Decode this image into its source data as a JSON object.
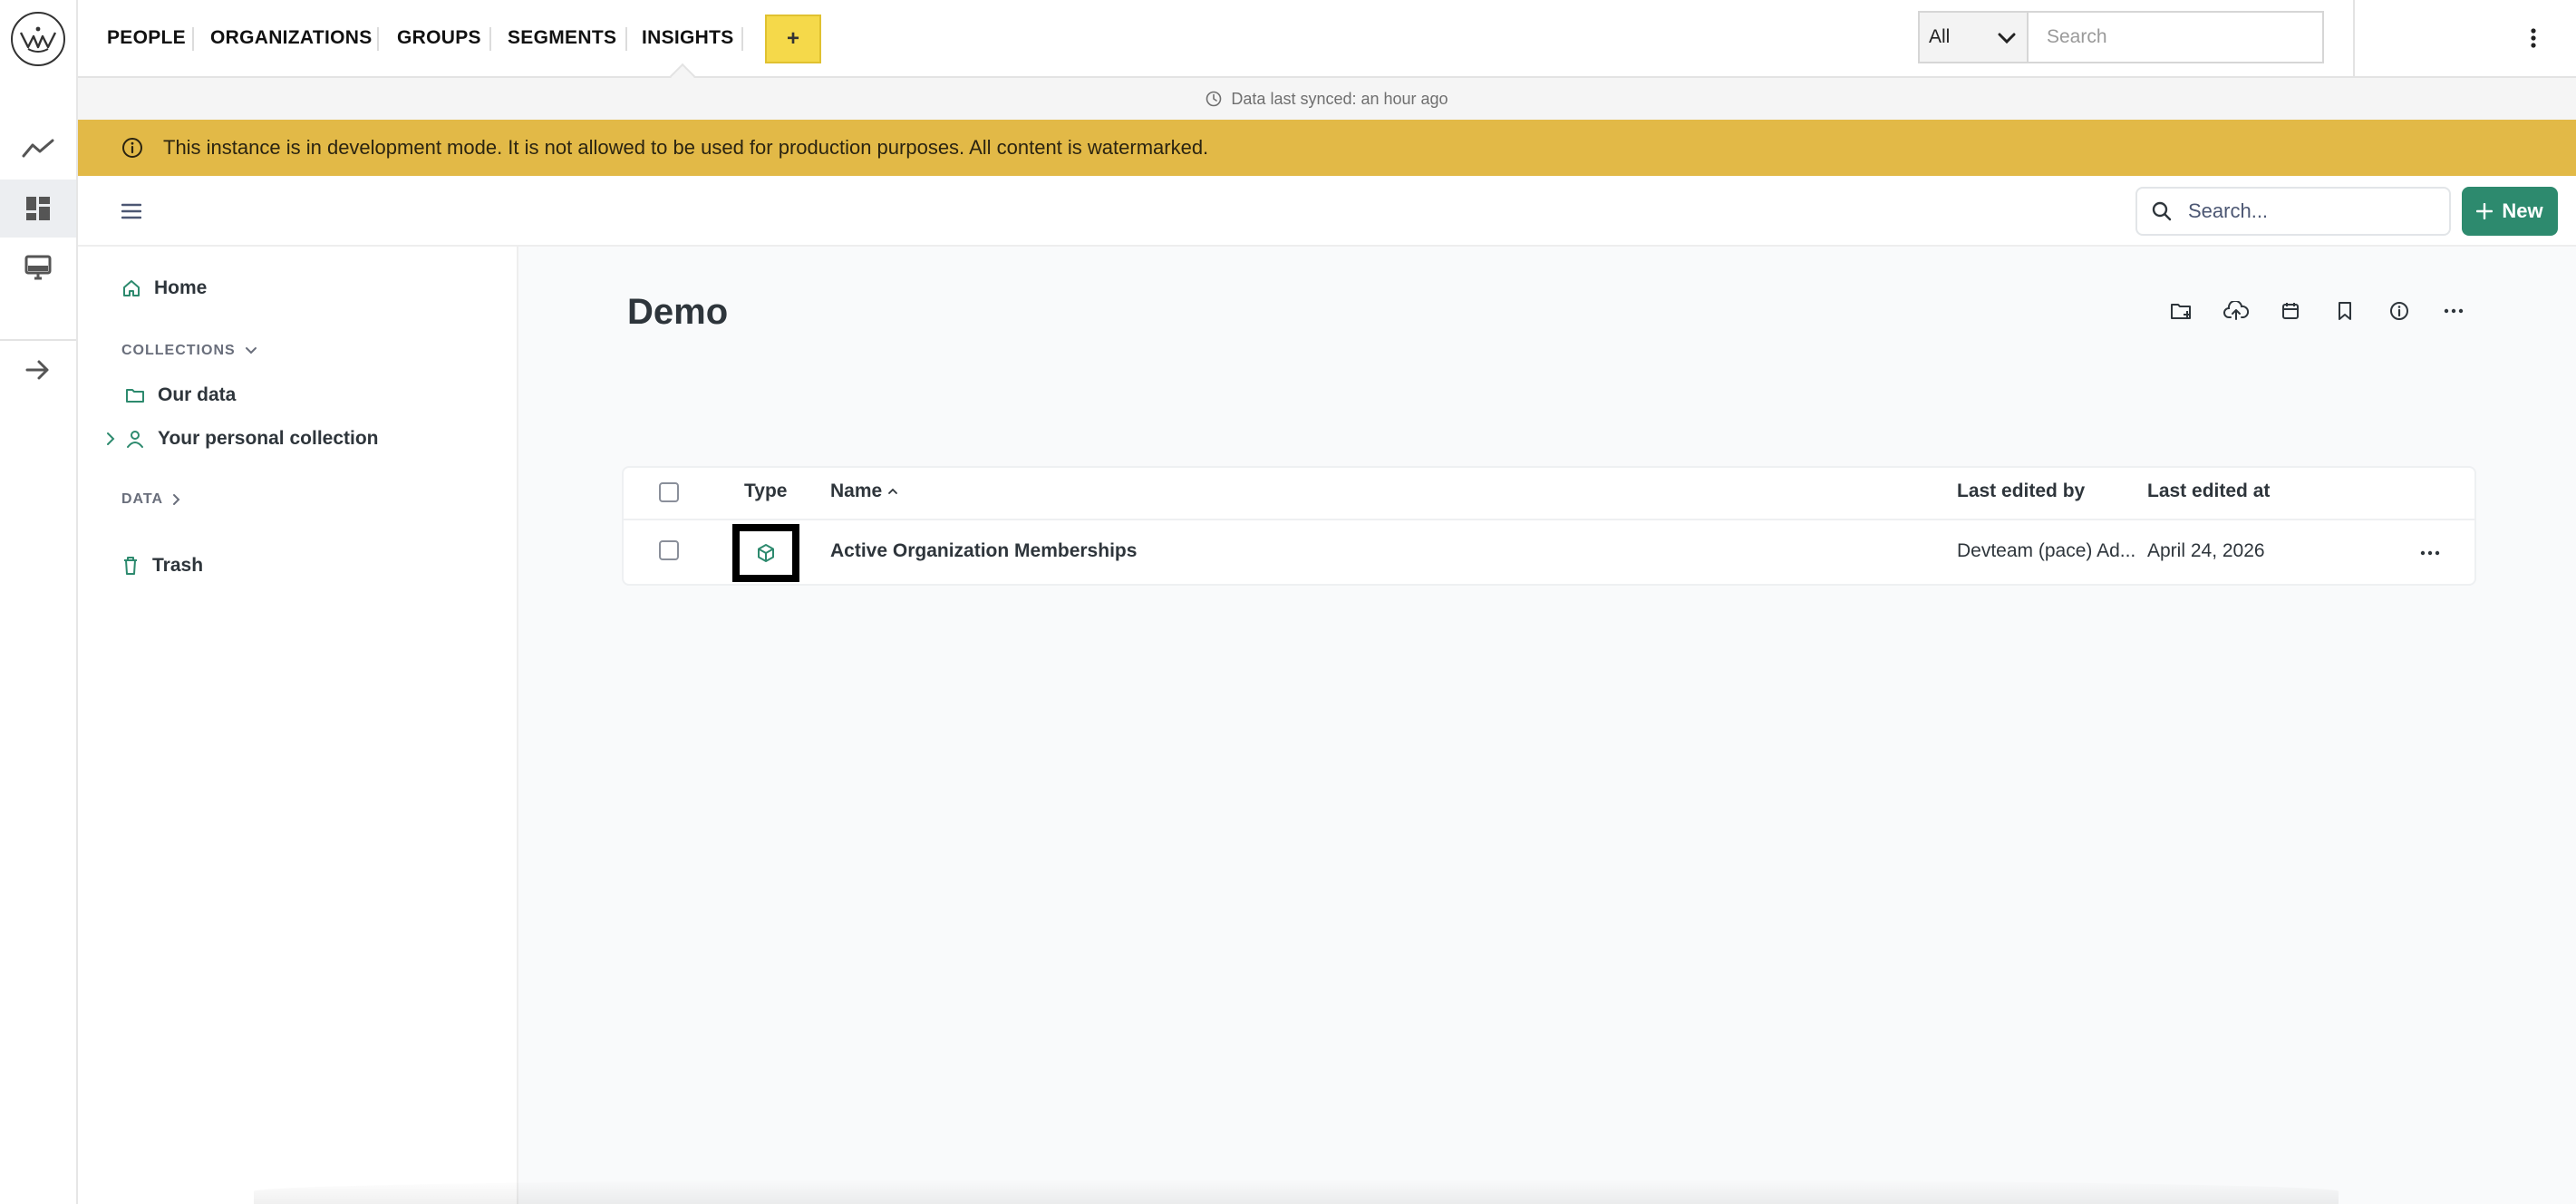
{
  "topbar": {
    "nav": [
      {
        "label": "PEOPLE"
      },
      {
        "label": "ORGANIZATIONS"
      },
      {
        "label": "GROUPS"
      },
      {
        "label": "SEGMENTS"
      },
      {
        "label": "INSIGHTS"
      }
    ],
    "plus_label": "+",
    "scope_value": "All",
    "search_placeholder": "Search"
  },
  "sync": {
    "text": "Data last synced: an hour ago"
  },
  "banner": {
    "text": "This instance is in development mode. It is not allowed to be used for production purposes. All content is watermarked.",
    "color": "#e2b947"
  },
  "header": {
    "search_placeholder": "Search...",
    "new_label": "New",
    "accent": "#2d8a6e"
  },
  "sidebar": {
    "home": "Home",
    "collections_label": "COLLECTIONS",
    "items": [
      {
        "label": "Our data",
        "icon": "folder-icon"
      },
      {
        "label": "Your personal collection",
        "icon": "person-icon"
      }
    ],
    "data_label": "DATA",
    "trash": "Trash"
  },
  "main": {
    "title": "Demo",
    "columns": {
      "type": "Type",
      "name": "Name",
      "last_edited_by": "Last edited by",
      "last_edited_at": "Last edited at"
    },
    "rows": [
      {
        "type_icon": "model-cube-icon",
        "name": "Active Organization Memberships",
        "last_edited_by": "Devteam (pace) Ad...",
        "last_edited_at": "April 24, 2026"
      }
    ]
  }
}
